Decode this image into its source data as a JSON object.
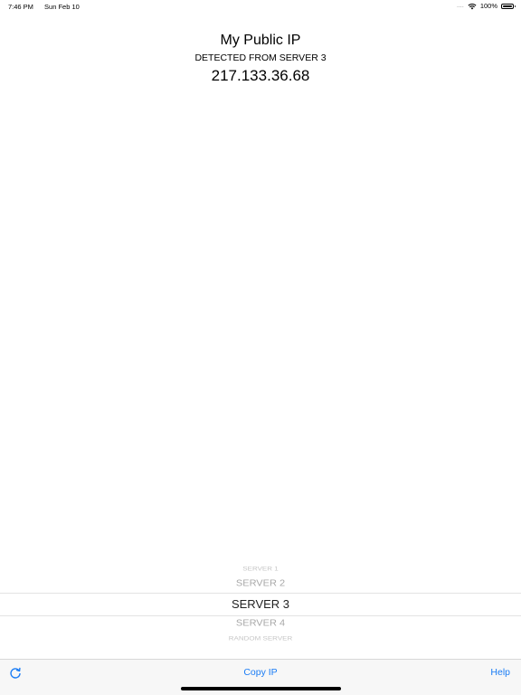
{
  "status_bar": {
    "time": "7:46 PM",
    "date": "Sun Feb 10",
    "signal": "....",
    "battery_percent": "100%",
    "battery_level": 1.0
  },
  "header": {
    "title": "My Public IP",
    "subtitle": "DETECTED FROM SERVER 3",
    "ip_address": "217.133.36.68"
  },
  "picker": {
    "items": [
      "SERVER 1",
      "SERVER 2",
      "SERVER 3",
      "SERVER 4",
      "RANDOM SERVER"
    ],
    "selected": "SERVER 3"
  },
  "toolbar": {
    "copy_label": "Copy IP",
    "help_label": "Help",
    "refresh_icon": "refresh-icon"
  },
  "colors": {
    "accent": "#1a7cf5",
    "toolbar_bg": "#f7f7f7"
  }
}
